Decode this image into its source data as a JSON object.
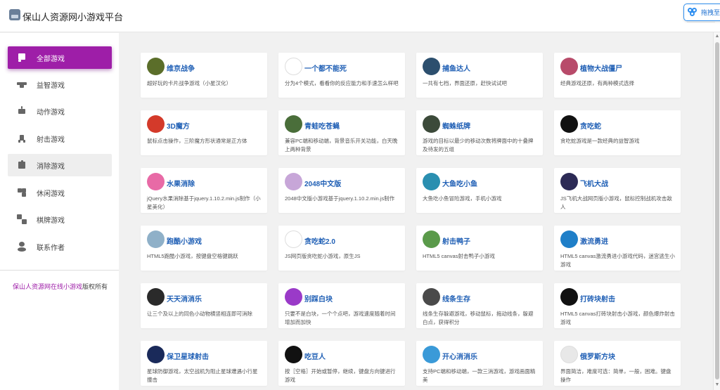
{
  "header": {
    "title": "保山人资源网小游戏平台",
    "top_button_label": "拖拽至"
  },
  "sidebar": {
    "items": [
      {
        "label": "全部游戏",
        "icon": "twitch-icon",
        "active": true
      },
      {
        "label": "益智游戏",
        "icon": "graduation-cap-icon"
      },
      {
        "label": "动作游戏",
        "icon": "reddit-icon"
      },
      {
        "label": "射击游戏",
        "icon": "rocket-icon"
      },
      {
        "label": "消除游戏",
        "icon": "puzzle-icon",
        "hover": true
      },
      {
        "label": "休闲游戏",
        "icon": "pinwheel-icon"
      },
      {
        "label": "棋牌游戏",
        "icon": "chessboard-icon"
      },
      {
        "label": "联系作者",
        "icon": "user-icon"
      }
    ],
    "copyright_link": "保山人资源网在线小游戏",
    "copyright_suffix": "版权所有"
  },
  "games": [
    {
      "title": "维京战争",
      "desc": "超好玩的卡片战争游戏（小星汉化）",
      "thumb_color": "#5b6e2a"
    },
    {
      "title": "一个都不能死",
      "desc": "分为4个模式，看看你的反应能力和手速怎么样吧",
      "thumb_color": "#ffffff"
    },
    {
      "title": "捕鱼达人",
      "desc": "一共有七档，界面还原，赶快试试吧",
      "thumb_color": "#2c4f6e"
    },
    {
      "title": "植物大战僵尸",
      "desc": "经典游戏还原，有两种模式选择",
      "thumb_color": "#b84b6a"
    },
    {
      "title": "3D魔方",
      "desc": "鼠标点击操作，三阶魔方形状通常是正方体",
      "thumb_color": "#d43a2a"
    },
    {
      "title": "青蛙吃苍蝇",
      "desc": "兼容PC端和移动端，背景音乐开关功能，白天晚上两种背景",
      "thumb_color": "#4a6e3a"
    },
    {
      "title": "蜘蛛纸牌",
      "desc": "游戏的目标以最少的移动次数将牌面中的十叠牌及待发的五组",
      "thumb_color": "#3c4a3a"
    },
    {
      "title": "贪吃蛇",
      "desc": "贪吃蛇游戏是一款经典的益智游戏",
      "thumb_color": "#111111"
    },
    {
      "title": "水果消除",
      "desc": "jQuery水果消除基于jquery.1.10.2.min.js制作（小星美化）",
      "thumb_color": "#e86aa6"
    },
    {
      "title": "2048中文版",
      "desc": "2048中文版小游戏基于jquery.1.10.2.min.js制作",
      "thumb_color": "#c7a6d8"
    },
    {
      "title": "大鱼吃小鱼",
      "desc": "大鱼吃小鱼冒险游戏，手机小游戏",
      "thumb_color": "#2a8fb0"
    },
    {
      "title": "飞机大战",
      "desc": "JS飞机大战网页版小游戏，鼠标控制战机攻击敌人",
      "thumb_color": "#2c2a55"
    },
    {
      "title": "跑酷小游戏",
      "desc": "HTML5跑酷小游戏，按键盘空格键跳跃",
      "thumb_color": "#8fb0c8"
    },
    {
      "title": "贪吃蛇2.0",
      "desc": "JS网页版贪吃蛇小游戏，原生JS",
      "thumb_color": "#ffffff"
    },
    {
      "title": "射击鸭子",
      "desc": "HTML5 canvas射击鸭子小游戏",
      "thumb_color": "#5a9a4a"
    },
    {
      "title": "激流勇进",
      "desc": "HTML5 canvas激流勇进小游戏代码，迷宫逃生小游戏",
      "thumb_color": "#1f7fc8"
    },
    {
      "title": "天天消消乐",
      "desc": "让三个及以上的同色小动物横竖相连即可消除",
      "thumb_color": "#2a2a2a"
    },
    {
      "title": "别踩白块",
      "desc": "只要不是白块，一个个点吧，游戏速度随着时间增加而加快",
      "thumb_color": "#9a3ac8"
    },
    {
      "title": "线条生存",
      "desc": "线条生存躲避游戏，移动鼠标，拖动线条，躲避白点，获得积分",
      "thumb_color": "#4a4a4a"
    },
    {
      "title": "打砖块射击",
      "desc": "HTML5 canvas打砖块射击小游戏，颜色爆炸射击游戏",
      "thumb_color": "#111111"
    },
    {
      "title": "保卫星球射击",
      "desc": "星球防御游戏，太空战机为阻止星球遭遇小行星撞击",
      "thumb_color": "#1a2a5a"
    },
    {
      "title": "吃豆人",
      "desc": "按［空格］开始或暂停，继续，键盘方向键进行游戏",
      "thumb_color": "#111111"
    },
    {
      "title": "开心消消乐",
      "desc": "支持PC端和移动端，一款三消游戏，游戏画面精美",
      "thumb_color": "#3a9ad8"
    },
    {
      "title": "俄罗斯方块",
      "desc": "界面简洁，难度可选：简单，一般，困难。键盘操作",
      "thumb_color": "#e8e8e8"
    }
  ]
}
